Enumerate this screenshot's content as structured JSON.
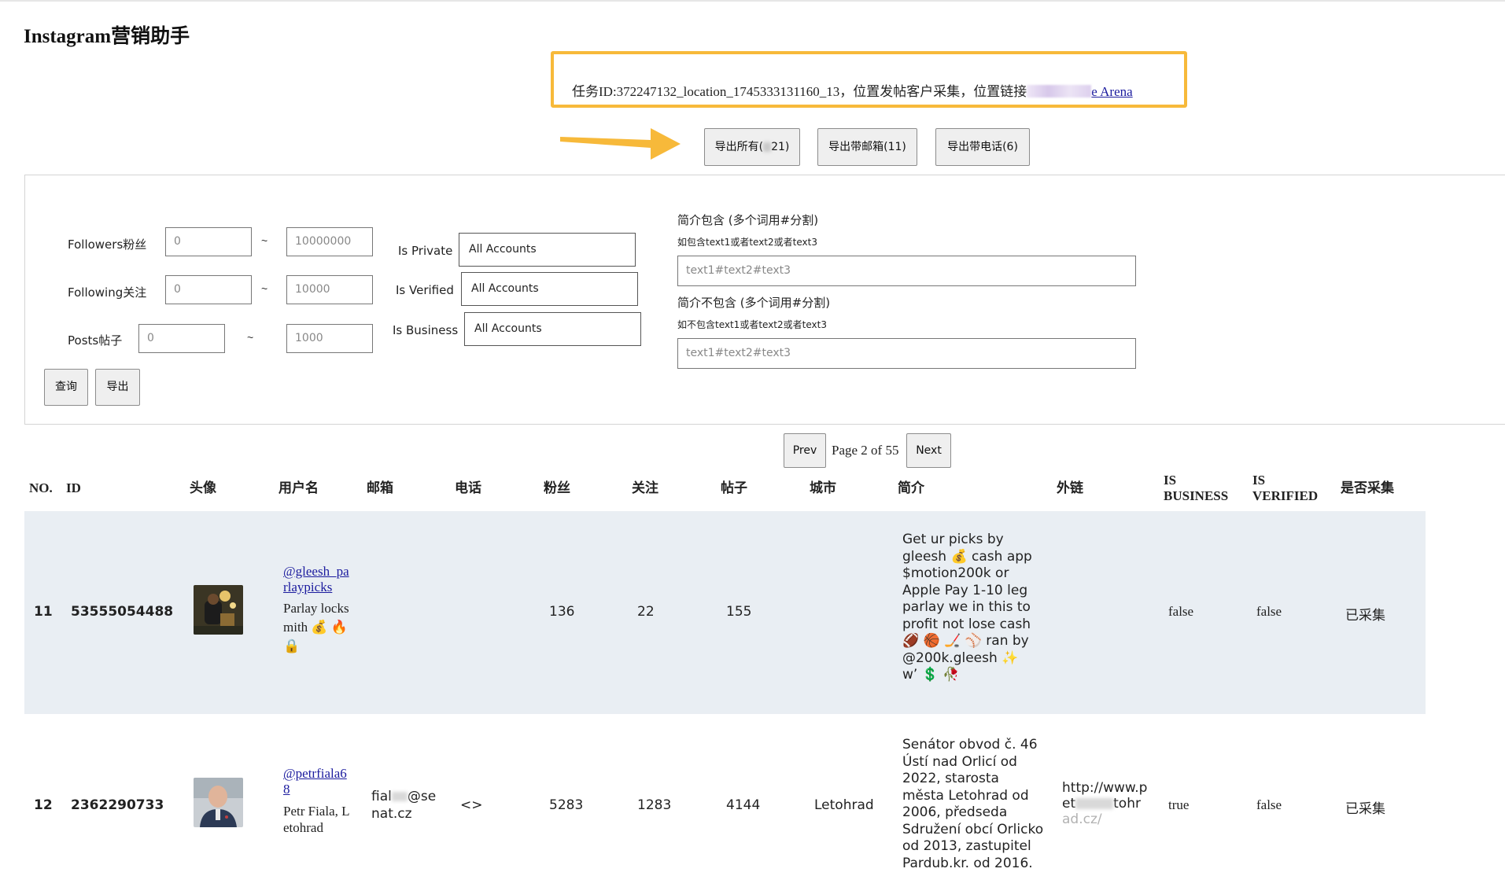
{
  "app": {
    "title": "Instagram营销助手"
  },
  "task": {
    "prefix": "任务ID:372247132_location_1745333131160_13，位置发帖客户采集，位置链接",
    "link_text": "e Arena"
  },
  "export_buttons": {
    "all_label_a": "导出所有(",
    "all_label_b": "21)",
    "email_label": "导出带邮箱(11)",
    "phone_label": "导出带电话(6)"
  },
  "filters": {
    "followers_label": "Followers粉丝",
    "followers_min": "0",
    "followers_max": "10000000",
    "following_label": "Following关注",
    "following_min": "0",
    "following_max": "10000",
    "posts_label": "Posts帖子",
    "posts_min": "0",
    "posts_max": "1000",
    "range_sep": "~",
    "is_private_label": "Is Private",
    "is_private_value": "All Accounts",
    "is_verified_label": "Is Verified",
    "is_verified_value": "All Accounts",
    "is_business_label": "Is Business",
    "is_business_value": "All Accounts",
    "bio_include_label": "简介包含 (多个词用#分割)",
    "bio_include_hint": "如包含text1或者text2或者text3",
    "bio_include_placeholder": "text1#text2#text3",
    "bio_exclude_label": "简介不包含 (多个词用#分割)",
    "bio_exclude_hint": "如不包含text1或者text2或者text3",
    "bio_exclude_placeholder": "text1#text2#text3",
    "query_label": "查询",
    "export_label": "导出"
  },
  "pagination": {
    "prev_label": "Prev",
    "page_text": "Page 2 of 55",
    "next_label": "Next"
  },
  "table": {
    "headers": {
      "no": "NO.",
      "id": "ID",
      "avatar": "头像",
      "username": "用户名",
      "email": "邮箱",
      "phone": "电话",
      "followers": "粉丝",
      "following": "关注",
      "posts": "帖子",
      "city": "城市",
      "bio": "简介",
      "link": "外链",
      "is_business_a": "IS",
      "is_business_b": "BUSINESS",
      "is_verified_a": "IS",
      "is_verified_b": "VERIFIED",
      "collected": "是否采集"
    },
    "rows": [
      {
        "no": "11",
        "id": "53555054488",
        "username_a": "@gleesh_pa",
        "username_b": "rlaypicks",
        "display_a": "Parlay locks",
        "display_b": "mith 💰 🔥",
        "display_c": "🔒",
        "email": "",
        "phone": "",
        "followers": "136",
        "following": "22",
        "posts": "155",
        "city": "",
        "bio": [
          "Get ur picks by",
          "gleesh 💰 cash app",
          "$motion200k or",
          "Apple Pay 1-10 leg",
          "parlay we in this to",
          "profit not lose cash",
          "🏈 🏀 🏒 ⚾ ran by",
          "@200k.gleesh ✨",
          "w’ 💲  🥀"
        ],
        "link": "",
        "is_business": "false",
        "is_verified": "false",
        "collected": "已采集"
      },
      {
        "no": "12",
        "id": "2362290733",
        "username_a": "@petrfiala6",
        "username_b": "8",
        "display_a": "Petr Fiala, L",
        "display_b": "etohrad",
        "email_a": "fial",
        "email_b": "@se",
        "email_c": "nat.cz",
        "phone": "<>",
        "followers": "5283",
        "following": "1283",
        "posts": "4144",
        "city": "Letohrad",
        "bio": [
          "Senátor obvod č. 46",
          "Ústí nad Orlicí od",
          "2022, starosta",
          "města Letohrad od",
          "2006, předseda",
          "Sdružení obcí Orlicko",
          "od 2013, zastupitel",
          "Pardub.kr. od 2016."
        ],
        "link_a": "http://www.p",
        "link_b": "et",
        "link_c": "tohr",
        "link_d": "ad.cz/",
        "is_business": "true",
        "is_verified": "false",
        "collected": "已采集"
      }
    ]
  },
  "colors": {
    "accent_border": "#f7b93a",
    "row_highlight": "#e9eef3",
    "link": "#1b1b9e"
  }
}
